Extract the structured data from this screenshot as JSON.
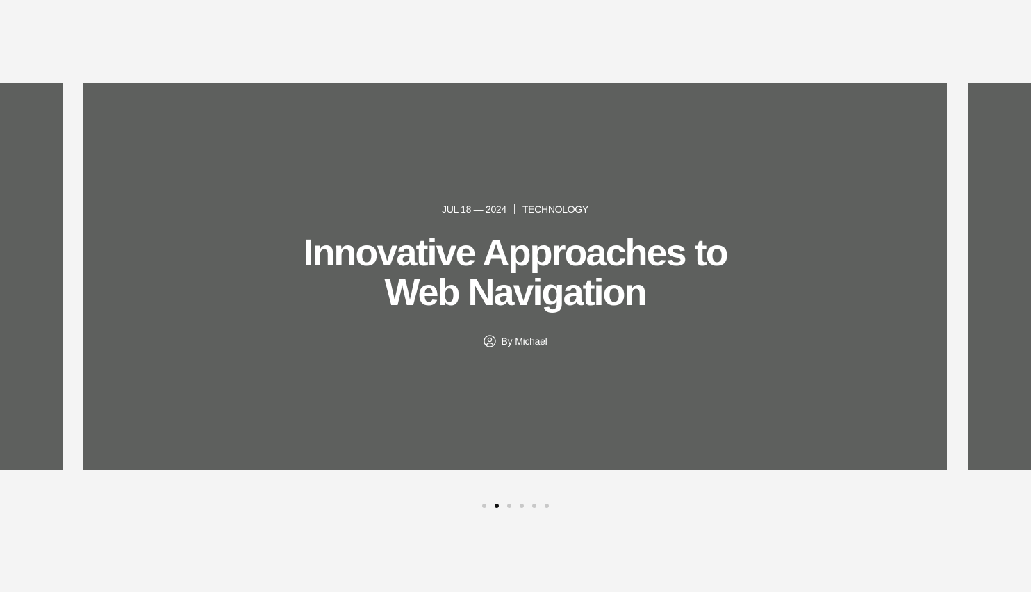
{
  "slider": {
    "current_slide": {
      "date": "JUL 18 — 2024",
      "category": "TECHNOLOGY",
      "title_line1": "Innovative Approaches to",
      "title_line2": "Web Navigation",
      "author_prefix": "By",
      "author_name": "Michael",
      "author_icon": "user-circle-icon"
    },
    "dots": {
      "count": 6,
      "active_index": 1
    }
  },
  "colors": {
    "page_background": "#f4f4f4",
    "slide_background": "#5e605e",
    "text": "#ffffff",
    "dot_inactive": "#c8c8c8",
    "dot_active": "#111111"
  }
}
